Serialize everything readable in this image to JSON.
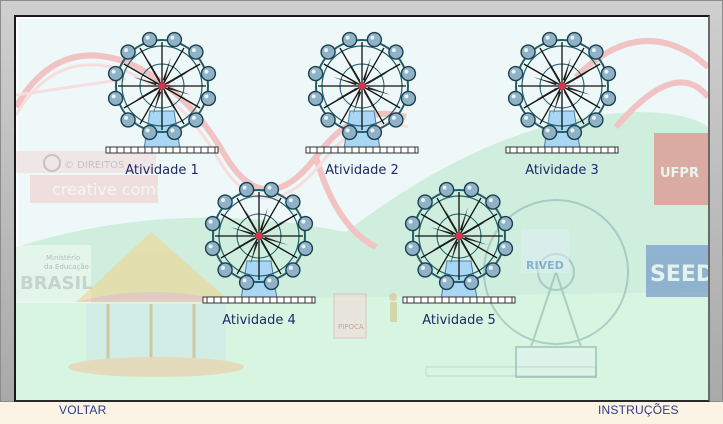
{
  "activities": [
    {
      "label": "Atividade 1"
    },
    {
      "label": "Atividade 2"
    },
    {
      "label": "Atividade 3"
    },
    {
      "label": "Atividade 4"
    },
    {
      "label": "Atividade 5"
    }
  ],
  "background": {
    "license_top": "© DIREITOS",
    "license_brand": "creative commons",
    "ministry_line1": "Ministério",
    "ministry_line2": "da Educação",
    "ministry_brand": "BRASIL",
    "stand_sign": "PIPOCA",
    "right_logo": "SEED",
    "rived_logo": "RIVED",
    "ufpr_logo": "UFPR"
  },
  "footer": {
    "back_label": "VOLTAR",
    "instructions_label": "INSTRUÇÕES"
  },
  "colors": {
    "wheel_frame": "#1f5e6a",
    "wheel_support": "#a9d6f5",
    "gondola": "#8fb2c7",
    "label_text": "#1f2a6a",
    "hub": "#e0304a"
  }
}
